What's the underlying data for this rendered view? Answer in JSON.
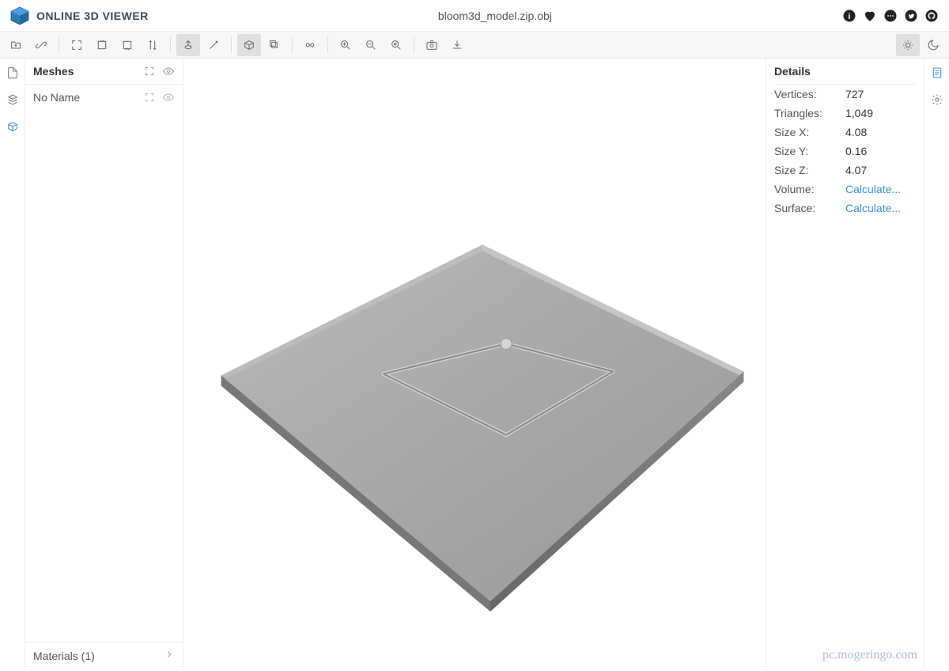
{
  "app": {
    "title": "ONLINE 3D VIEWER"
  },
  "file": {
    "name": "bloom3d_model.zip.obj"
  },
  "left_panel": {
    "title": "Meshes",
    "items": [
      {
        "name": "No Name"
      }
    ],
    "footer": "Materials (1)"
  },
  "right_panel": {
    "title": "Details",
    "rows": [
      {
        "label": "Vertices:",
        "value": "727",
        "link": false
      },
      {
        "label": "Triangles:",
        "value": "1,049",
        "link": false
      },
      {
        "label": "Size X:",
        "value": "4.08",
        "link": false
      },
      {
        "label": "Size Y:",
        "value": "0.16",
        "link": false
      },
      {
        "label": "Size Z:",
        "value": "4.07",
        "link": false
      },
      {
        "label": "Volume:",
        "value": "Calculate...",
        "link": true
      },
      {
        "label": "Surface:",
        "value": "Calculate...",
        "link": true
      }
    ]
  },
  "watermark": "pc.mogeringo.com"
}
